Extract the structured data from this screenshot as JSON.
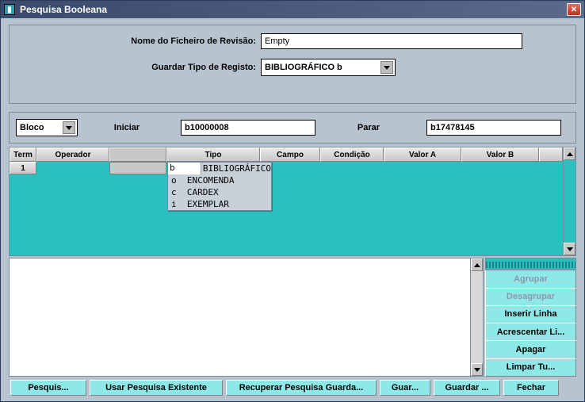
{
  "titlebar": {
    "title": "Pesquisa Booleana"
  },
  "top": {
    "file_label": "Nome do Ficheiro de Revisão:",
    "file_value": "Empty",
    "type_label": "Guardar Tipo de Registo:",
    "type_value": "BIBLIOGRÁFICO  b"
  },
  "range": {
    "mode": "Bloco",
    "start_label": "Iniciar",
    "start_value": "b10000008",
    "stop_label": "Parar",
    "stop_value": "b17478145"
  },
  "grid": {
    "headers": {
      "term": "Term",
      "operador": "Operador",
      "tipo": "Tipo",
      "campo": "Campo",
      "condicao": "Condição",
      "valor_a": "Valor A",
      "valor_b": "Valor B"
    },
    "row1_term": "1",
    "row1_type_input": "b",
    "row1_type_display": "BIBLIOGRÁFICO",
    "type_options": [
      {
        "code": "o",
        "label": "ENCOMENDA"
      },
      {
        "code": "c",
        "label": "CARDEX"
      },
      {
        "code": "i",
        "label": "EXEMPLAR"
      }
    ]
  },
  "side": {
    "agrupar": "Agrupar",
    "desagrupar": "Desagrupar",
    "inserir": "Inserir Linha",
    "acrescentar": "Acrescentar Li...",
    "apagar": "Apagar",
    "limpar": "Limpar Tu..."
  },
  "bottom": {
    "pesquis": "Pesquis...",
    "usar": "Usar Pesquisa Existente",
    "recuperar": "Recuperar Pesquisa Guarda...",
    "guar": "Guar...",
    "guardar": "Guardar ...",
    "fechar": "Fechar"
  }
}
